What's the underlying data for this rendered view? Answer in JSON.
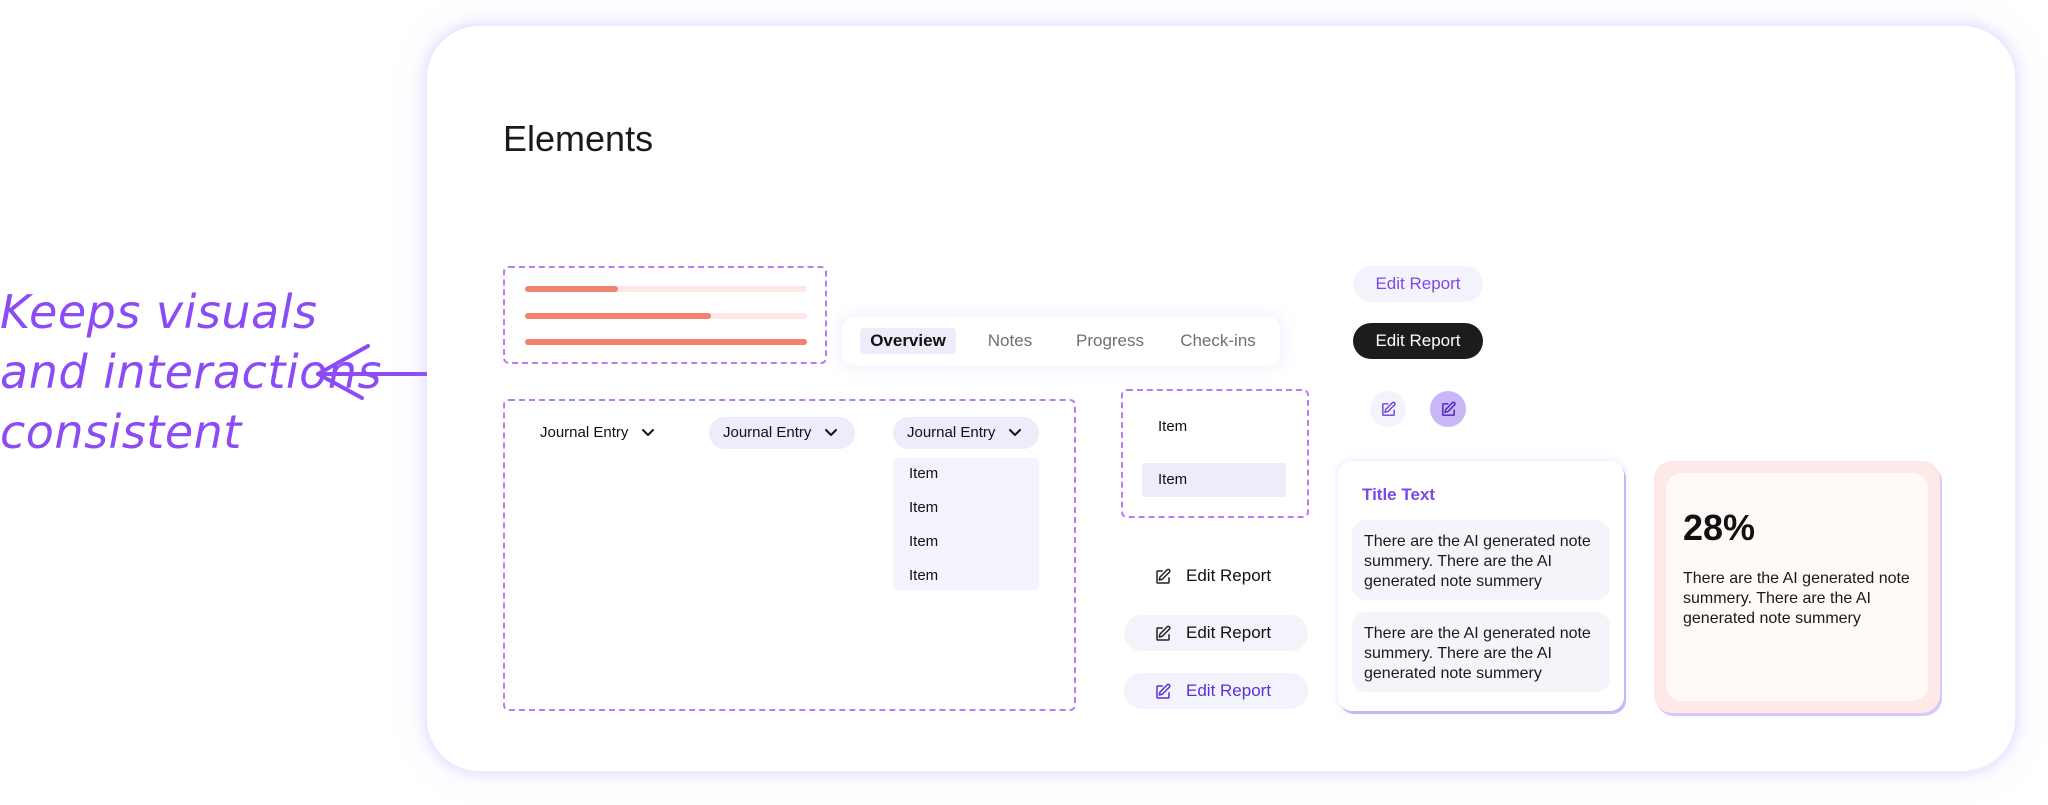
{
  "annotation": {
    "lines": [
      "Keeps visuals",
      "and interactions",
      "consistent"
    ]
  },
  "page": {
    "title": "Elements"
  },
  "progress_bars": [
    {
      "fill_fraction": 0.33
    },
    {
      "fill_fraction": 0.66
    },
    {
      "fill_fraction": 1.0
    }
  ],
  "tabs": [
    {
      "label": "Overview",
      "active": true
    },
    {
      "label": "Notes",
      "active": false
    },
    {
      "label": "Progress",
      "active": false
    },
    {
      "label": "Check-ins",
      "active": false
    }
  ],
  "dropdowns": [
    {
      "label": "Journal Entry",
      "state": "default"
    },
    {
      "label": "Journal Entry",
      "state": "hover"
    },
    {
      "label": "Journal Entry",
      "state": "open"
    }
  ],
  "dropdown_menu": {
    "items": [
      "Item",
      "Item",
      "Item",
      "Item"
    ]
  },
  "list": {
    "items": [
      "Item",
      "Item"
    ],
    "selected_index": 1
  },
  "edit_buttons": [
    {
      "label": "Edit Report",
      "variant": "default"
    },
    {
      "label": "Edit Report",
      "variant": "hover"
    },
    {
      "label": "Edit Report",
      "variant": "active"
    }
  ],
  "pill_buttons": [
    {
      "label": "Edit Report",
      "variant": "light"
    },
    {
      "label": "Edit Report",
      "variant": "dark"
    }
  ],
  "icon_buttons": [
    {
      "icon": "edit-icon",
      "variant": "light"
    },
    {
      "icon": "edit-icon",
      "variant": "active"
    }
  ],
  "summary_card": {
    "title": "Title Text",
    "notes": [
      "There are the AI generated note summery. There are the AI generated note summery",
      "There are the AI generated note summery. There are the AI generated note summery"
    ]
  },
  "stat_card": {
    "value": "28%",
    "text": "There are the AI generated note summery. There are the AI generated note summery"
  },
  "colors": {
    "accent": "#8b4cf5",
    "accent_dark": "#6c3fd8",
    "progress": "#f2816f",
    "progress_track": "#fde8e6",
    "tab_active_bg": "#ececfb",
    "dark_button": "#1c1c1c",
    "stat_card_bg": "#fde9e7"
  }
}
